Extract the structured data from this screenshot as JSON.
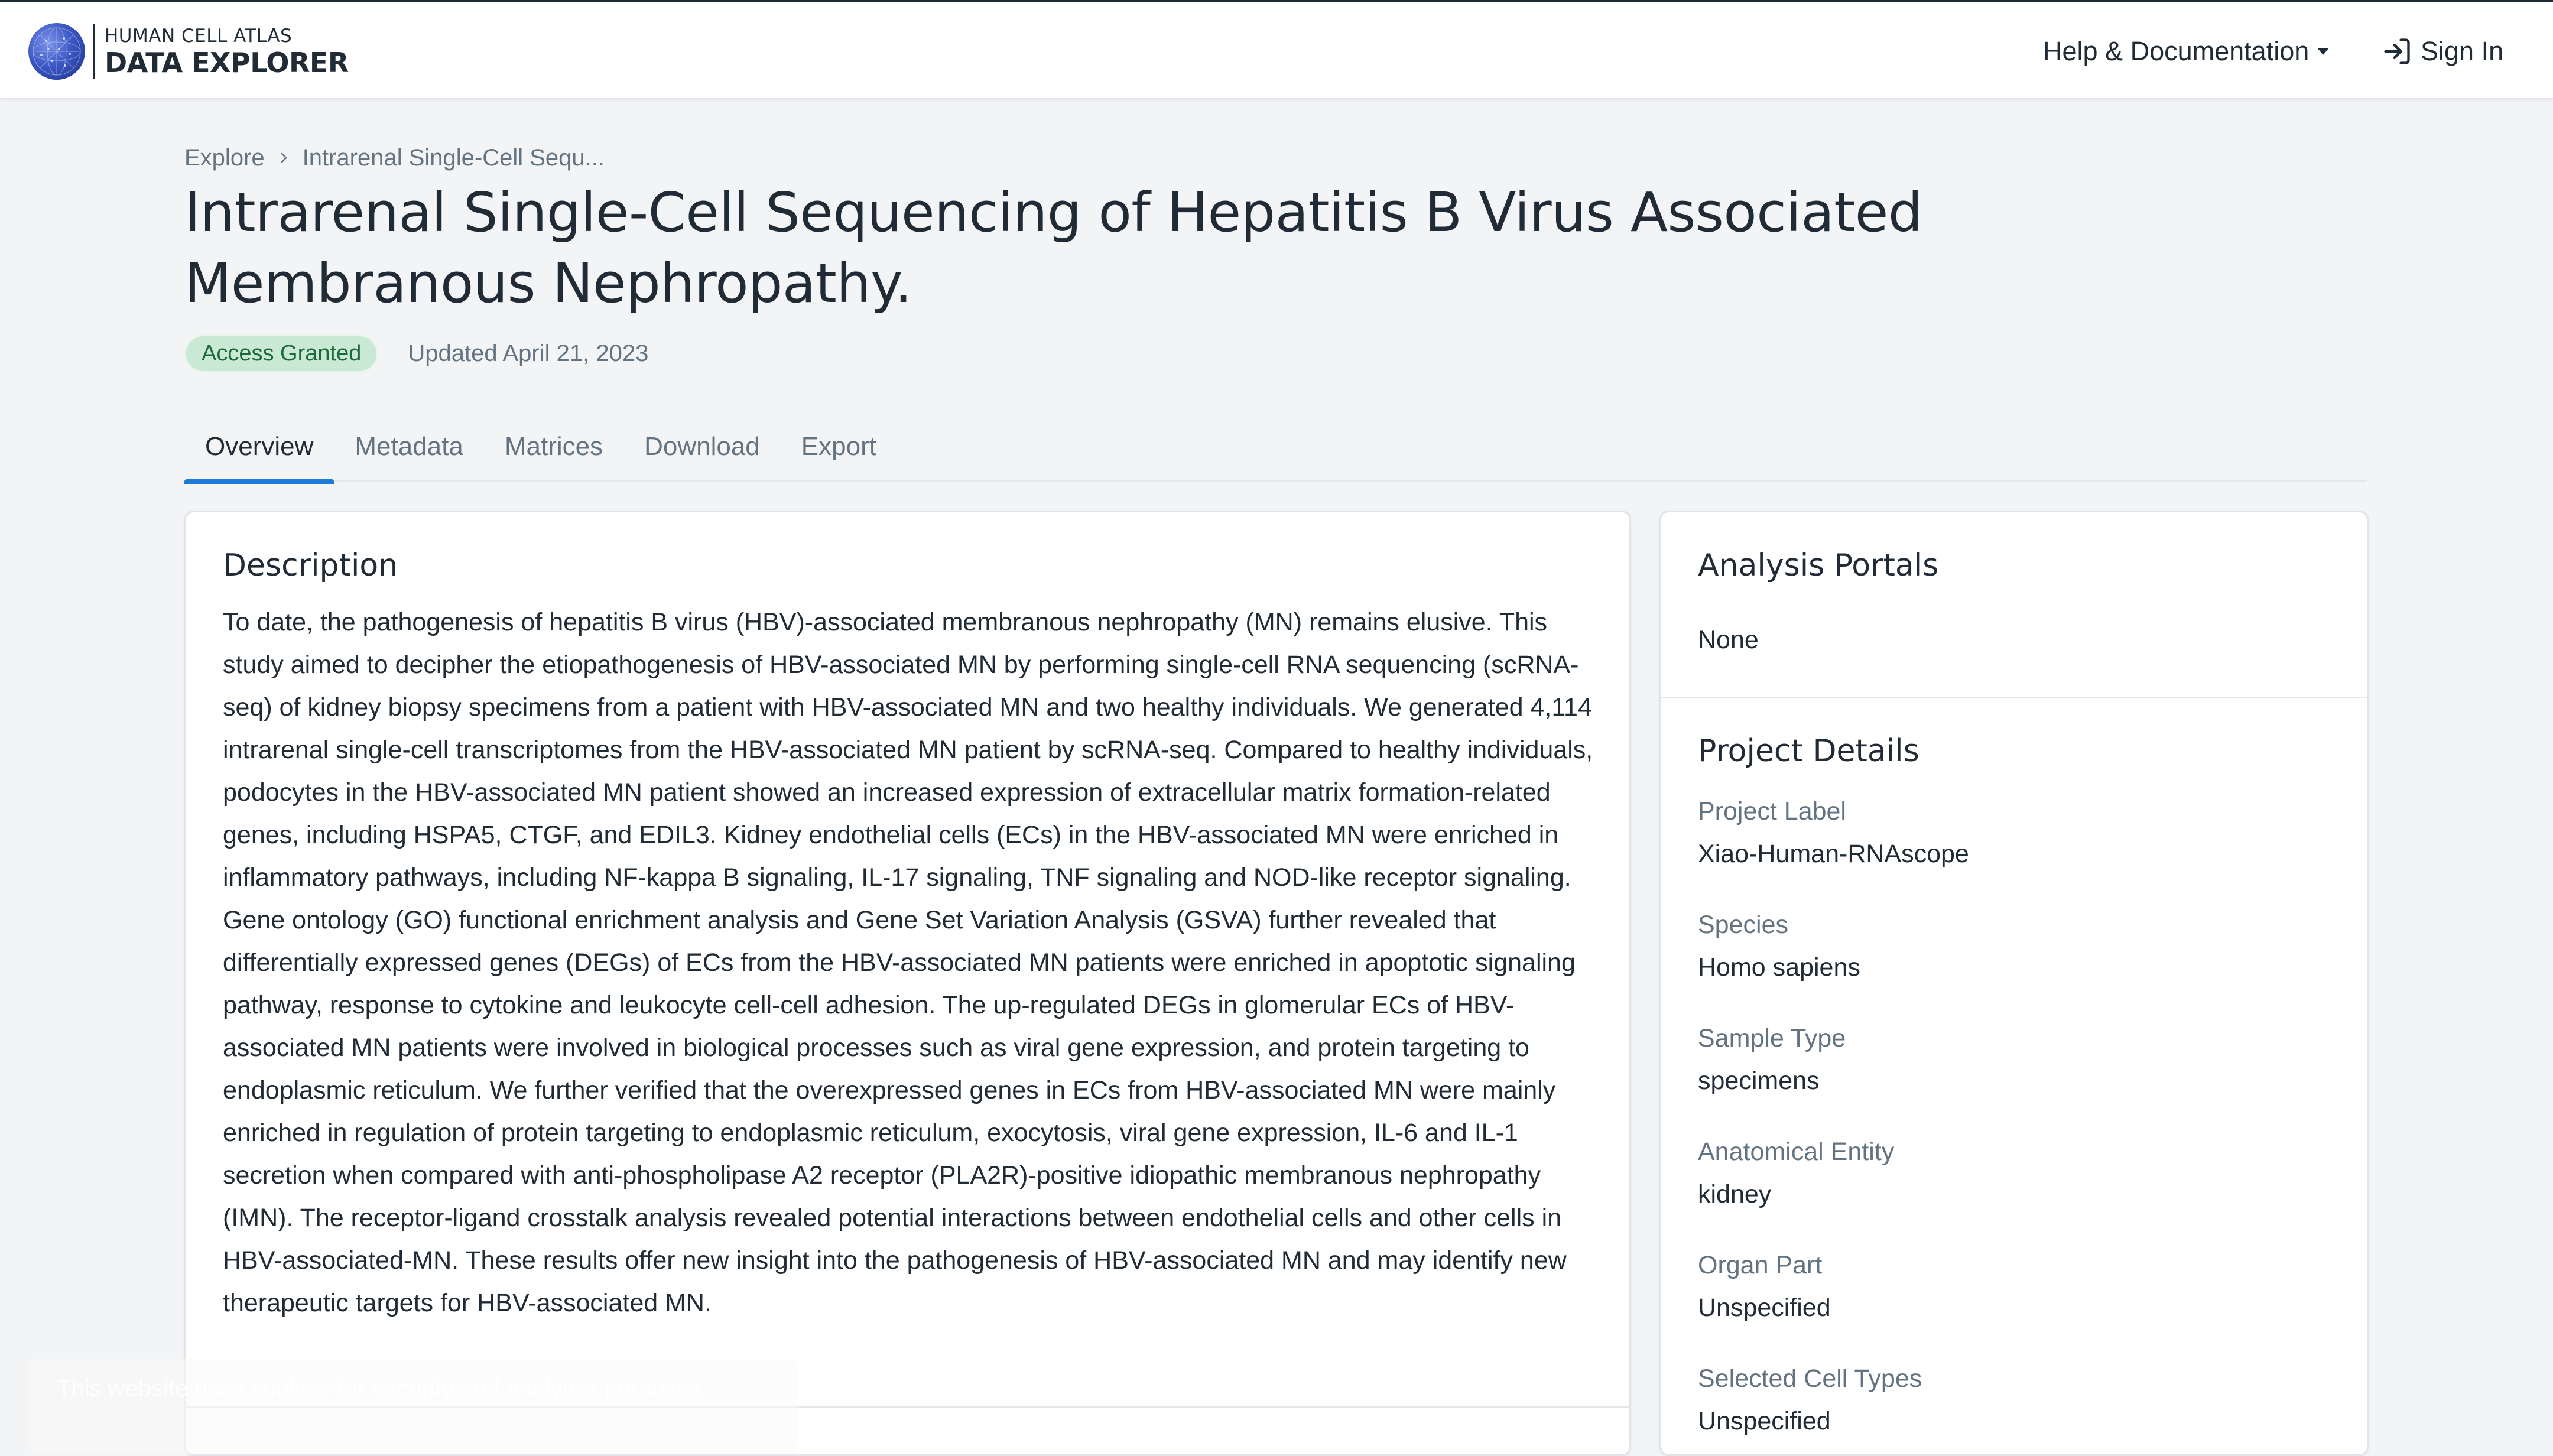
{
  "header": {
    "logo_line1": "HUMAN CELL ATLAS",
    "logo_line2": "DATA EXPLORER",
    "help_label": "Help & Documentation",
    "signin_label": "Sign In"
  },
  "breadcrumb": {
    "root": "Explore",
    "current": "Intrarenal Single-Cell Sequ..."
  },
  "project": {
    "title": "Intrarenal Single-Cell Sequencing of Hepatitis B Virus Associated Membranous Nephropathy.",
    "access_badge": "Access Granted",
    "updated": "Updated April 21, 2023"
  },
  "tabs": [
    {
      "label": "Overview",
      "active": true
    },
    {
      "label": "Metadata",
      "active": false
    },
    {
      "label": "Matrices",
      "active": false
    },
    {
      "label": "Download",
      "active": false
    },
    {
      "label": "Export",
      "active": false
    }
  ],
  "description": {
    "heading": "Description",
    "text": "To date, the pathogenesis of hepatitis B virus (HBV)-associated membranous nephropathy (MN) remains elusive. This study aimed to decipher the etiopathogenesis of HBV-associated MN by performing single-cell RNA sequencing (scRNA-seq) of kidney biopsy specimens from a patient with HBV-associated MN and two healthy individuals. We generated 4,114 intrarenal single-cell transcriptomes from the HBV-associated MN patient by scRNA-seq. Compared to healthy individuals, podocytes in the HBV-associated MN patient showed an increased expression of extracellular matrix formation-related genes, including HSPA5, CTGF, and EDIL3. Kidney endothelial cells (ECs) in the HBV-associated MN were enriched in inflammatory pathways, including NF-kappa B signaling, IL-17 signaling, TNF signaling and NOD-like receptor signaling. Gene ontology (GO) functional enrichment analysis and Gene Set Variation Analysis (GSVA) further revealed that differentially expressed genes (DEGs) of ECs from the HBV-associated MN patients were enriched in apoptotic signaling pathway, response to cytokine and leukocyte cell-cell adhesion. The up-regulated DEGs in glomerular ECs of HBV-associated MN patients were involved in biological processes such as viral gene expression, and protein targeting to endoplasmic reticulum. We further verified that the overexpressed genes in ECs from HBV-associated MN were mainly enriched in regulation of protein targeting to endoplasmic reticulum, exocytosis, viral gene expression, IL-6 and IL-1 secretion when compared with anti-phospholipase A2 receptor (PLA2R)-positive idiopathic membranous nephropathy (IMN). The receptor-ligand crosstalk analysis revealed potential interactions between endothelial cells and other cells in HBV-associated-MN. These results offer new insight into the pathogenesis of HBV-associated MN and may identify new therapeutic targets for HBV-associated MN."
  },
  "analysis_portals": {
    "heading": "Analysis Portals",
    "value": "None"
  },
  "project_details": {
    "heading": "Project Details",
    "fields": [
      {
        "label": "Project Label",
        "value": "Xiao-Human-RNAscope"
      },
      {
        "label": "Species",
        "value": "Homo sapiens"
      },
      {
        "label": "Sample Type",
        "value": "specimens"
      },
      {
        "label": "Anatomical Entity",
        "value": "kidney"
      },
      {
        "label": "Organ Part",
        "value": "Unspecified"
      },
      {
        "label": "Selected Cell Types",
        "value": "Unspecified"
      }
    ]
  },
  "cookie_banner": {
    "text": "This website uses cookies for security and analytics purposes."
  },
  "colors": {
    "accent": "#1c7cd5",
    "badge_bg": "#c9e9d5",
    "badge_text": "#1a6a3a"
  }
}
